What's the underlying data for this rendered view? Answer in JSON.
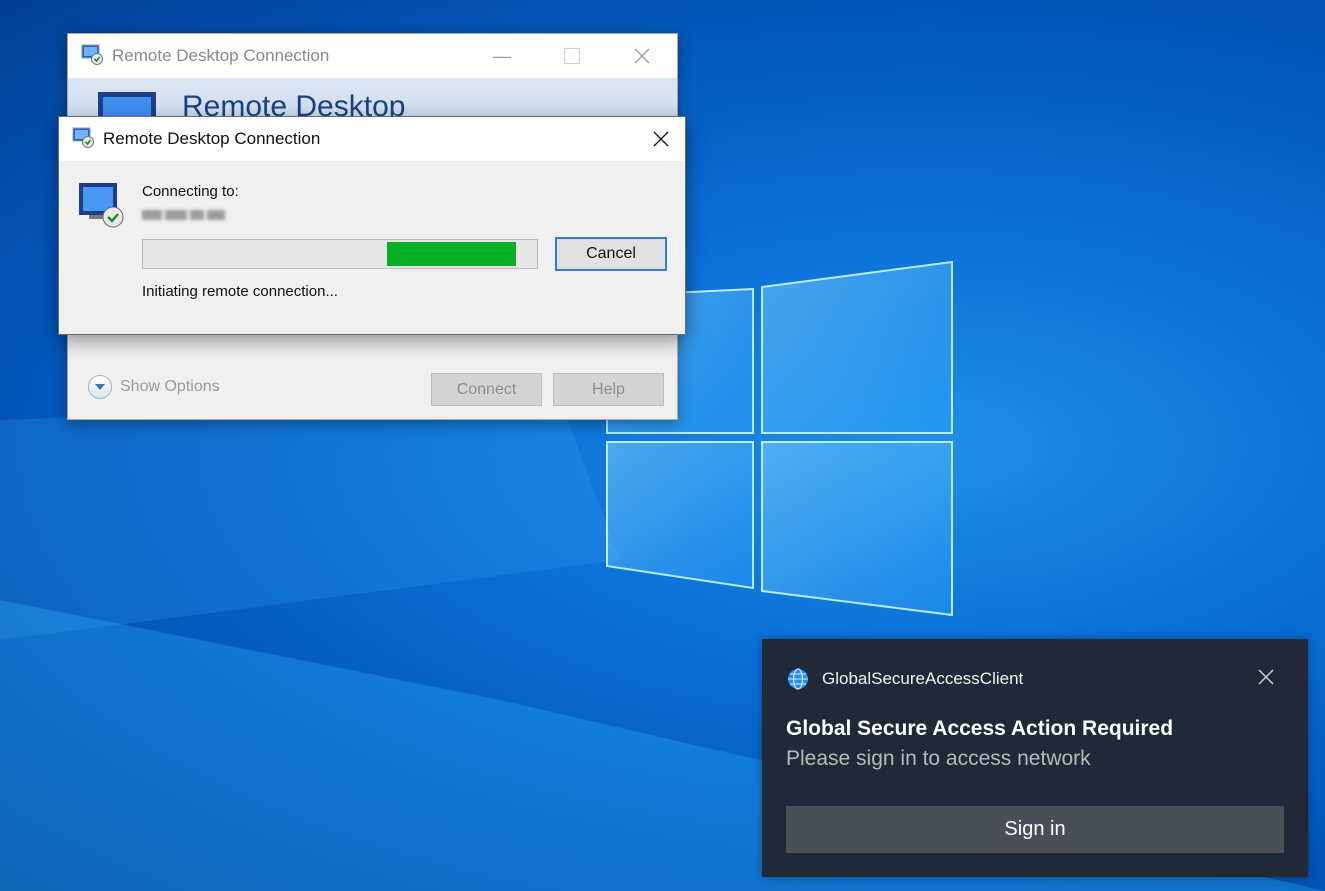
{
  "background_window": {
    "title": "Remote Desktop Connection",
    "banner_title": "Remote Desktop",
    "show_options_label": "Show Options",
    "connect_label": "Connect",
    "help_label": "Help"
  },
  "dialog": {
    "title": "Remote Desktop Connection",
    "connecting_label": "Connecting to:",
    "progress_fraction": 0.33,
    "cancel_label": "Cancel",
    "status": "Initiating remote connection..."
  },
  "toast": {
    "app_name": "GlobalSecureAccessClient",
    "title": "Global Secure Access Action Required",
    "body": "Please sign in to access network",
    "sign_in_label": "Sign in"
  },
  "colors": {
    "desktop_blue": "#0a6fd6",
    "progress_green": "#06b025",
    "toast_bg": "#1f2937",
    "accent": "#2f7bd6"
  },
  "icons": [
    "rdc-app-icon",
    "rdc-monitor-icon",
    "show-options-icon",
    "close-icon",
    "globe-icon"
  ]
}
